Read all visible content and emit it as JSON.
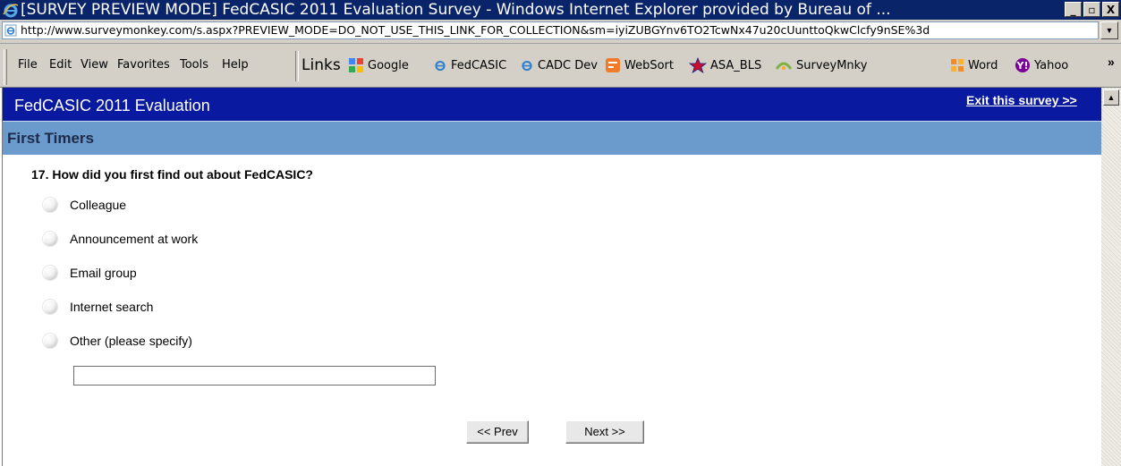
{
  "window": {
    "title": "[SURVEY PREVIEW MODE] FedCASIC 2011 Evaluation Survey - Windows Internet Explorer provided by Bureau of ...",
    "minimize": "_",
    "maximize": "▫",
    "close": "X"
  },
  "address_bar": {
    "url": "http://www.surveymonkey.com/s.aspx?PREVIEW_MODE=DO_NOT_USE_THIS_LINK_FOR_COLLECTION&sm=iyiZUBGYnv6TO2TcwNx47u20cUunttoQkwClcfy9nSE%3d"
  },
  "menu": {
    "items": [
      "File",
      "Edit",
      "View",
      "Favorites",
      "Tools",
      "Help"
    ]
  },
  "links": {
    "label": "Links",
    "items": [
      {
        "label": "Google",
        "icon": "google-icon"
      },
      {
        "label": "FedCASIC",
        "icon": "ie-page-icon"
      },
      {
        "label": "CADC Dev",
        "icon": "ie-page-icon"
      },
      {
        "label": "WebSort",
        "icon": "websort-icon"
      },
      {
        "label": "ASA_BLS",
        "icon": "star-icon"
      },
      {
        "label": "SurveyMnky",
        "icon": "surveymonkey-icon"
      },
      {
        "label": "Word",
        "icon": "word-icon"
      },
      {
        "label": "Yahoo",
        "icon": "yahoo-icon"
      }
    ],
    "overflow": "»"
  },
  "survey": {
    "title": "FedCASIC 2011 Evaluation",
    "exit_link": "Exit this survey >>",
    "page_title": "First Timers",
    "question": "17. How did you first find out about FedCASIC?",
    "options": [
      "Colleague",
      "Announcement at work",
      "Email group",
      "Internet search",
      "Other (please specify)"
    ],
    "other_value": "",
    "prev_button": "<< Prev",
    "next_button": "Next >>"
  },
  "colors": {
    "header_bg": "#0a1aa0",
    "page_header_bg": "#6b9acc",
    "titlebar_bg": "#0a246a"
  }
}
